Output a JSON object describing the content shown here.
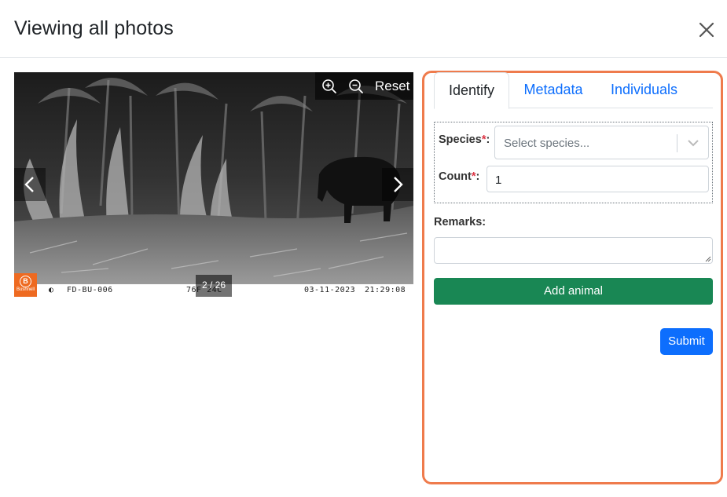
{
  "modal": {
    "title": "Viewing all photos"
  },
  "viewer": {
    "zoom_in_icon": "zoom-in-icon",
    "zoom_out_icon": "zoom-out-icon",
    "reset_label": "Reset",
    "counter": "2 / 26",
    "prev_icon": "chevron-left-icon",
    "next_icon": "chevron-right-icon",
    "camera_info": {
      "brand": "Bushnell",
      "camera_id": "FD-BU-006",
      "temperature": "76F 24C",
      "date": "03-11-2023",
      "time": "21:29:08"
    }
  },
  "tabs": [
    {
      "label": "Identify",
      "active": true
    },
    {
      "label": "Metadata",
      "active": false
    },
    {
      "label": "Individuals",
      "active": false
    }
  ],
  "form": {
    "species_label": "Species",
    "species_placeholder": "Select species...",
    "count_label": "Count",
    "count_value": "1",
    "remarks_label": "Remarks:",
    "required_marker": "*",
    "label_colon": ":",
    "add_button": "Add animal",
    "submit_button": "Submit"
  },
  "colors": {
    "accent_border": "#ef7b4c",
    "add_button": "#198754",
    "submit_button": "#0d6efd",
    "link": "#0d6efd",
    "required": "#dc3545"
  }
}
